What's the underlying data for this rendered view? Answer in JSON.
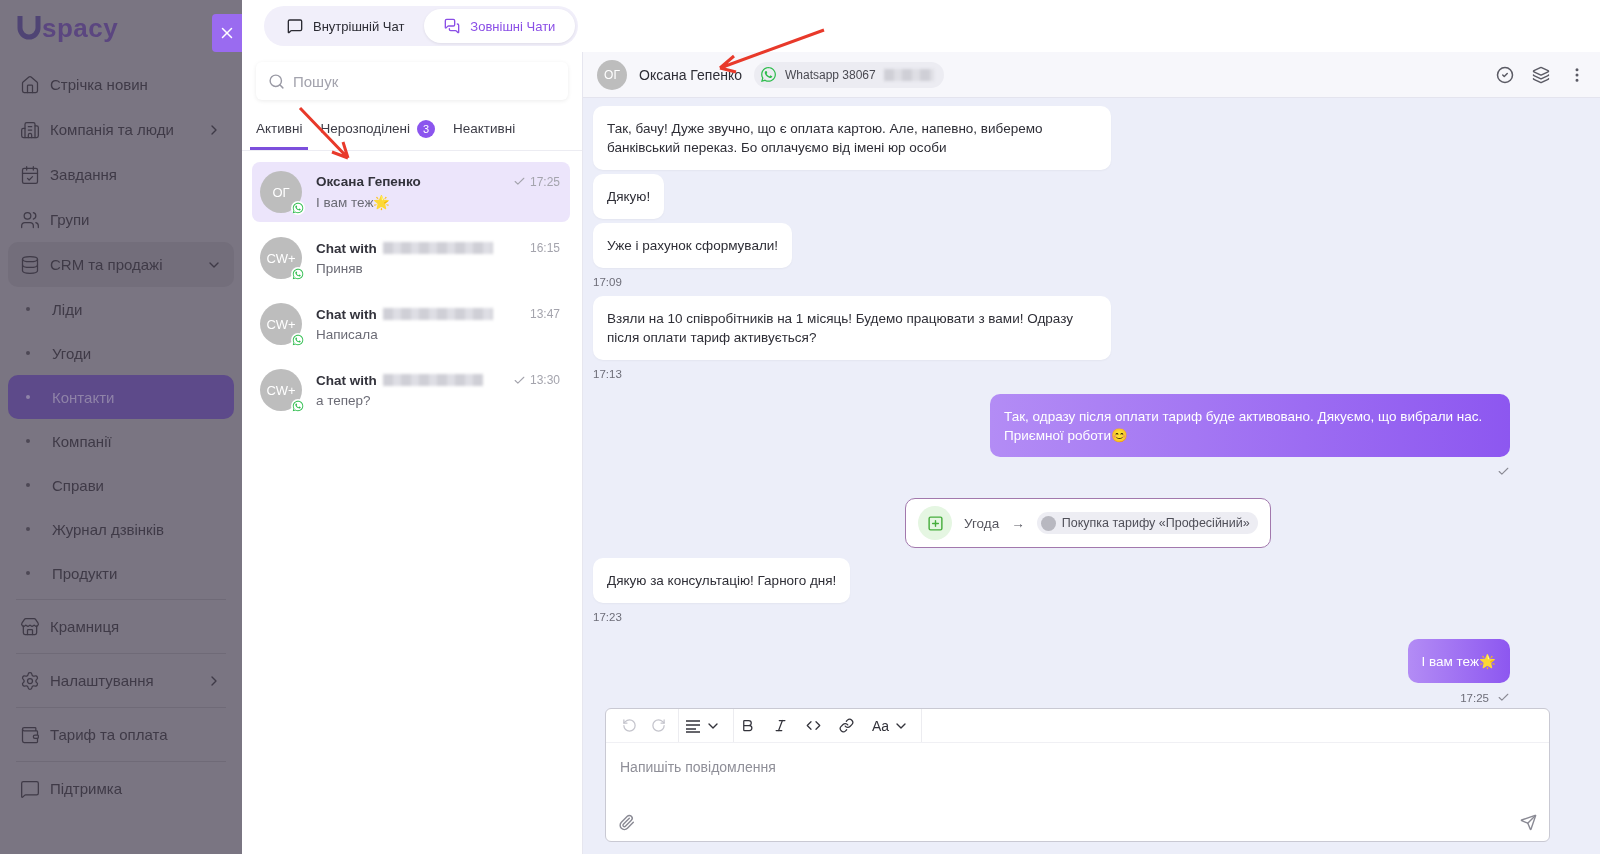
{
  "sidebar": {
    "logo": "spacy",
    "items": [
      {
        "label": "Стрічка новин",
        "selected": false
      },
      {
        "label": "Компанія та люди",
        "selected": false,
        "expanded": false
      },
      {
        "label": "Завдання",
        "selected": false
      },
      {
        "label": "Групи",
        "selected": false
      },
      {
        "label": "CRM та продажі",
        "selected": false,
        "expanded": true,
        "children": [
          {
            "label": "Ліди",
            "selected": false
          },
          {
            "label": "Угоди",
            "selected": false
          },
          {
            "label": "Контакти",
            "selected": true
          },
          {
            "label": "Компанії",
            "selected": false
          },
          {
            "label": "Справи",
            "selected": false
          },
          {
            "label": "Журнал дзвінків",
            "selected": false
          },
          {
            "label": "Продукти",
            "selected": false
          }
        ]
      },
      {
        "label": "Крамниця",
        "selected": false
      },
      {
        "label": "Налаштування",
        "selected": false,
        "expanded": false
      },
      {
        "label": "Тариф та оплата",
        "selected": false
      },
      {
        "label": "Підтримка",
        "selected": false
      }
    ]
  },
  "top_tabs": [
    {
      "label": "Внутрішній Чат",
      "selected": false
    },
    {
      "label": "Зовнішні Чати",
      "selected": true
    }
  ],
  "chat_list": {
    "search": {
      "placeholder": "Пошук"
    },
    "tabs": [
      {
        "label": "Активні",
        "selected": true
      },
      {
        "label": "Нерозподілені",
        "badge": "3",
        "selected": false
      },
      {
        "label": "Неактивні",
        "selected": false
      }
    ],
    "chats": [
      {
        "initials": "ОГ",
        "name": "Оксана Гепенко",
        "redacted": false,
        "preview": "І вам теж🌟",
        "time": "17:25",
        "read": true,
        "selected": true
      },
      {
        "initials": "CW+",
        "name": "Chat with",
        "redacted": true,
        "preview": "Приняв",
        "time": "16:15",
        "read": false,
        "selected": false
      },
      {
        "initials": "CW+",
        "name": "Chat with",
        "redacted": true,
        "preview": "Написала",
        "time": "13:47",
        "read": false,
        "selected": false
      },
      {
        "initials": "CW+",
        "name": "Chat with",
        "redacted": true,
        "preview": "а тепер?",
        "time": "13:30",
        "read": true,
        "selected": false
      }
    ]
  },
  "conversation": {
    "initials": "ОГ",
    "name": "Оксана Гепенко",
    "channel": "Whatsapp 38067",
    "channel_redacted": true,
    "messages": [
      {
        "kind": "incoming",
        "text": "Так, бачу! Дуже звучно, що є оплата картою. Але, напевно, виберемо банківський переказ. Бо оплачуємо від імені юр особи"
      },
      {
        "kind": "incoming",
        "text": "Дякую!"
      },
      {
        "kind": "incoming",
        "text": "Уже і рахунок сформували!",
        "time": "17:09"
      },
      {
        "kind": "incoming",
        "text": "Взяли на 10 співробітників на 1 місяць! Будемо працювати з вами! Одразу після оплати тариф активується?",
        "time": "17:13"
      },
      {
        "kind": "outgoing",
        "text": "Так, одразу після оплати тариф буде активовано. Дякуємо, що вибрали нас. Приємної роботи😊",
        "read": true
      },
      {
        "kind": "deal",
        "label": "Угода",
        "arrow": "→",
        "deal": "Покупка тарифу «Професійний»"
      },
      {
        "kind": "incoming",
        "text": "Дякую за консультацію! Гарного дня!",
        "time": "17:23"
      },
      {
        "kind": "outgoing",
        "text": "І вам теж🌟",
        "time": "17:25",
        "read": true
      }
    ],
    "composer": {
      "font_button": "Aa",
      "placeholder": "Напишіть повідомлення"
    }
  }
}
